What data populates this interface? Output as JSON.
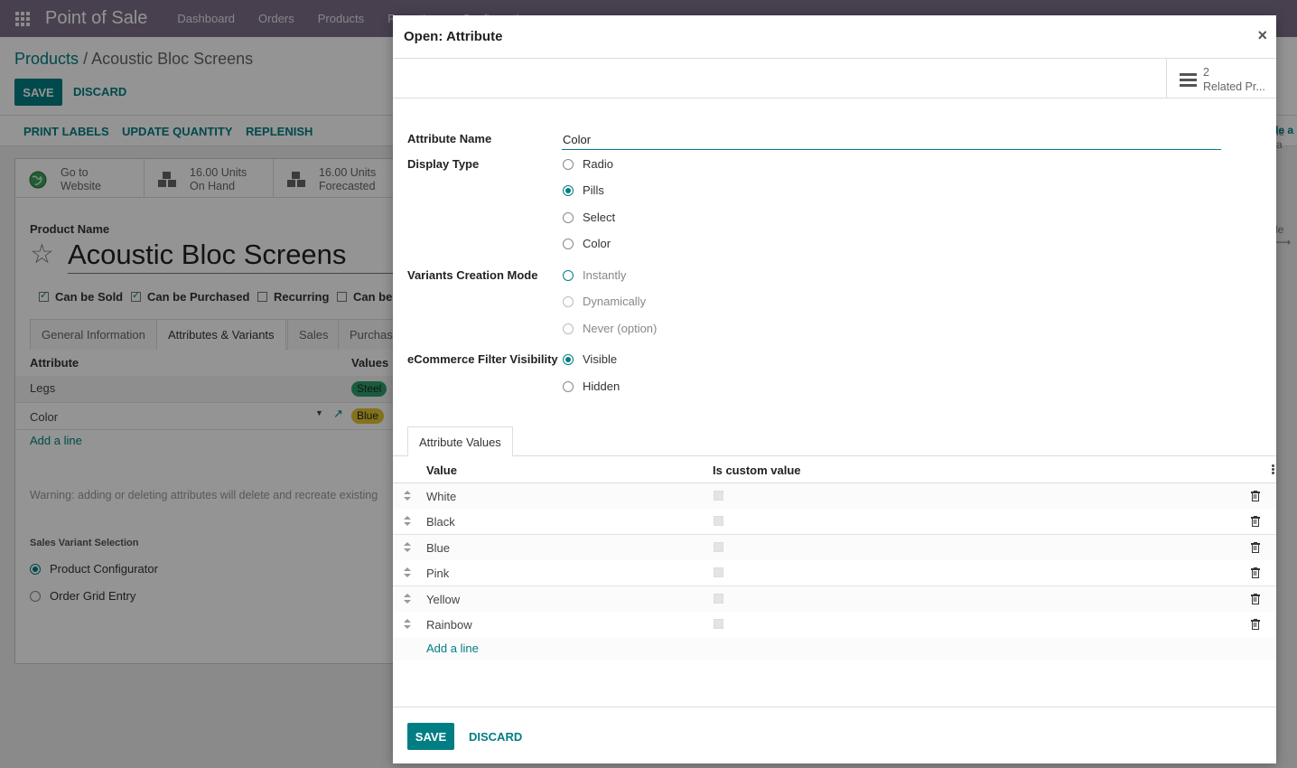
{
  "navbar": {
    "brand": "Point of Sale",
    "menus": [
      "Dashboard",
      "Orders",
      "Products",
      "Reporting",
      "Configuration"
    ]
  },
  "background_form": {
    "breadcrumb_root": "Products",
    "breadcrumb_current": "Acoustic Bloc Screens",
    "save_label": "SAVE",
    "discard_label": "DISCARD",
    "actions": [
      "PRINT LABELS",
      "UPDATE QUANTITY",
      "REPLENISH"
    ],
    "stat_buttons": [
      {
        "line1": "Go to",
        "line2": "Website",
        "icon": "globe-icon"
      },
      {
        "line1": "16.00 Units",
        "line2": "On Hand",
        "icon": "cubes-icon"
      },
      {
        "line1": "16.00 Units",
        "line2": "Forecasted",
        "icon": "cubes-icon"
      }
    ],
    "product_name_label": "Product Name",
    "product_name": "Acoustic Bloc Screens",
    "checkboxes": [
      {
        "label": "Can be Sold",
        "checked": true
      },
      {
        "label": "Can be Purchased",
        "checked": true
      },
      {
        "label": "Recurring",
        "checked": false
      },
      {
        "label": "Can be",
        "checked": false
      }
    ],
    "tabs": [
      "General Information",
      "Attributes & Variants",
      "Sales",
      "Purchas"
    ],
    "table_headers": [
      "Attribute",
      "Values"
    ],
    "rows": [
      {
        "attribute": "Legs",
        "chip": "Steel",
        "chip_color": "#2e9f6b"
      },
      {
        "attribute": "Color",
        "chip": "Blue",
        "chip_color": "#e4c430"
      }
    ],
    "add_line": "Add a line",
    "warning_prefix": "Warning:",
    "warning_text": "adding or deleting attributes will delete and recreate existing",
    "sales_variant_title": "Sales Variant Selection",
    "sales_variant_options": [
      {
        "label": "Product Configurator",
        "selected": true
      },
      {
        "label": "Order Grid Entry",
        "selected": false
      }
    ],
    "right_fragments": [
      "le a",
      "le ⟶"
    ]
  },
  "modal": {
    "title": "Open: Attribute",
    "close_symbol": "×",
    "related_count": "2",
    "related_label": "Related Pr...",
    "fields": {
      "attribute_name_label": "Attribute Name",
      "attribute_name_value": "Color",
      "display_type_label": "Display Type",
      "display_type_options": [
        {
          "label": "Radio",
          "selected": false
        },
        {
          "label": "Pills",
          "selected": true
        },
        {
          "label": "Select",
          "selected": false
        },
        {
          "label": "Color",
          "selected": false
        }
      ],
      "variants_mode_label": "Variants Creation Mode",
      "variants_mode_options": [
        {
          "label": "Instantly",
          "selected": false
        },
        {
          "label": "Dynamically",
          "selected": false
        },
        {
          "label": "Never (option)",
          "selected": false
        }
      ],
      "ecommerce_label": "eCommerce Filter Visibility",
      "ecommerce_options": [
        {
          "label": "Visible",
          "selected": true
        },
        {
          "label": "Hidden",
          "selected": false
        }
      ]
    },
    "tab_label": "Attribute Values",
    "columns": {
      "value": "Value",
      "custom": "Is custom value"
    },
    "values": [
      {
        "value": "White",
        "is_custom": false
      },
      {
        "value": "Black",
        "is_custom": false
      },
      {
        "value": "Blue",
        "is_custom": false
      },
      {
        "value": "Pink",
        "is_custom": false
      },
      {
        "value": "Yellow",
        "is_custom": false
      },
      {
        "value": "Rainbow",
        "is_custom": false
      }
    ],
    "add_line": "Add a line",
    "save_label": "SAVE",
    "discard_label": "DISCARD",
    "accent_color": "#017e84"
  }
}
